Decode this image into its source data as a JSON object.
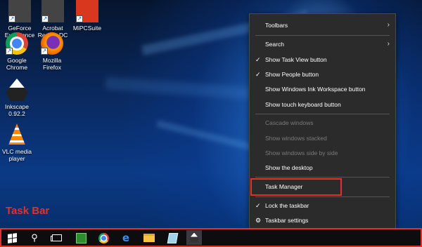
{
  "desktop_icons": [
    {
      "label": "GeForce\nExperience",
      "icon": "geforce-icon"
    },
    {
      "label": "Acrobat\nReader DC",
      "icon": "acrobat-icon"
    },
    {
      "label": "MiPCSuite",
      "icon": "mipcsuite-icon"
    },
    {
      "label": "Google\nChrome",
      "icon": "chrome-icon"
    },
    {
      "label": "Mozilla\nFirefox",
      "icon": "firefox-icon"
    },
    {
      "label": "Inkscape\n0.92.2",
      "icon": "inkscape-icon"
    },
    {
      "label": "VLC media\nplayer",
      "icon": "vlc-icon"
    }
  ],
  "annotation": {
    "label": "Task Bar",
    "color": "#e0322a"
  },
  "context_menu": {
    "items": [
      {
        "label": "Toolbars",
        "submenu": true
      },
      {
        "label": "Search",
        "submenu": true
      },
      {
        "label": "Show Task View button",
        "checked": true
      },
      {
        "label": "Show People button",
        "checked": true
      },
      {
        "label": "Show Windows Ink Workspace button"
      },
      {
        "label": "Show touch keyboard button"
      },
      {
        "label": "Cascade windows",
        "disabled": true
      },
      {
        "label": "Show windows stacked",
        "disabled": true
      },
      {
        "label": "Show windows side by side",
        "disabled": true
      },
      {
        "label": "Show the desktop"
      },
      {
        "label": "Task Manager",
        "highlighted": true
      },
      {
        "label": "Lock the taskbar",
        "checked": true
      },
      {
        "label": "Taskbar settings",
        "icon": "gear-icon"
      }
    ]
  },
  "taskbar": {
    "items": [
      "start-icon",
      "search-icon",
      "task-view-icon",
      "app-icon",
      "chrome-icon",
      "edge-icon",
      "file-explorer-icon",
      "sticky-notes-icon",
      "inkscape-icon"
    ],
    "active": "inkscape-icon"
  }
}
